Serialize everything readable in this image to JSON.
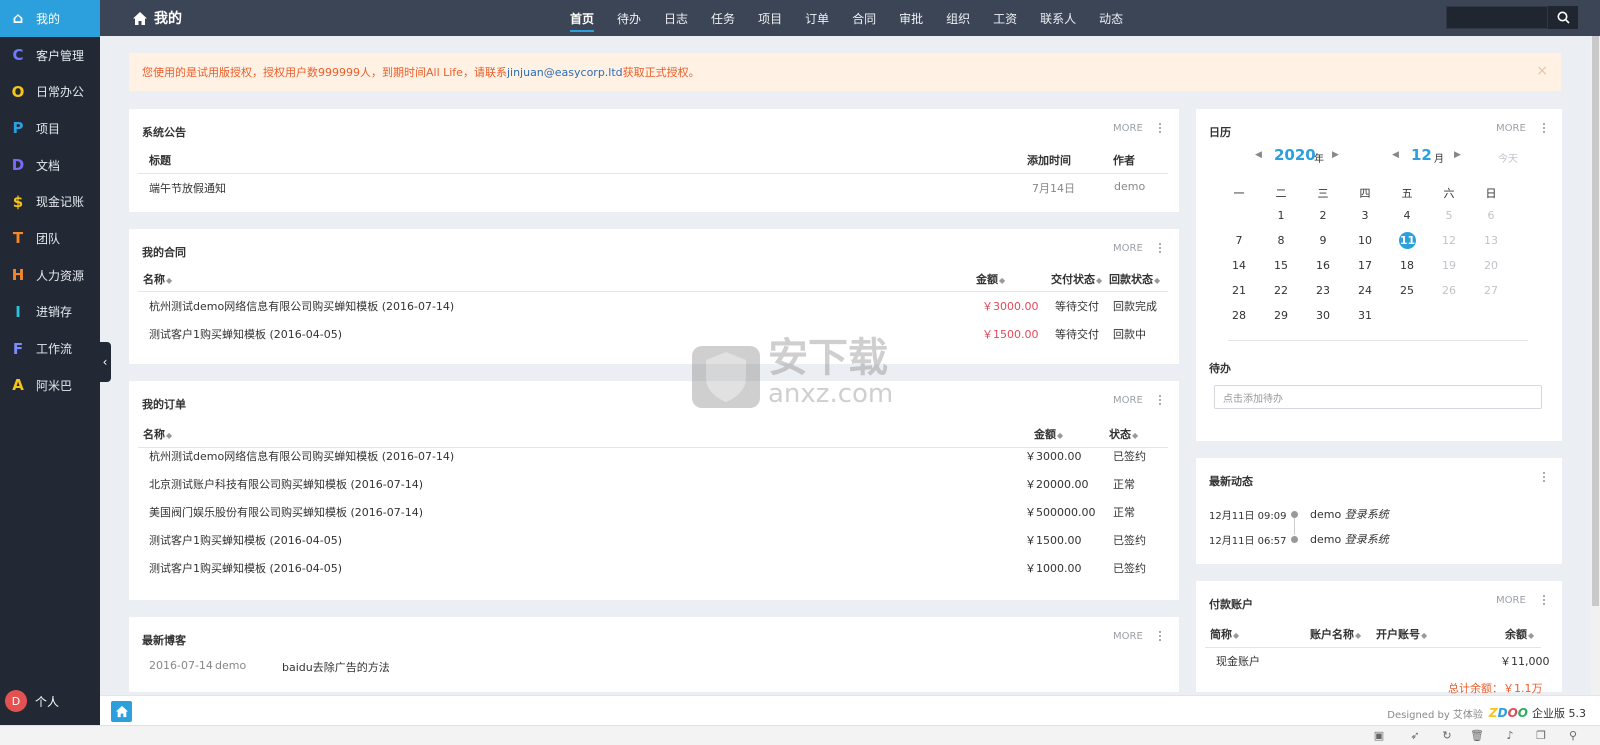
{
  "sidebar": {
    "items": [
      {
        "letter": "⌂",
        "label": "我的",
        "color": "#ffffff",
        "active": true
      },
      {
        "letter": "C",
        "label": "客户管理",
        "color": "#6c7cff"
      },
      {
        "letter": "O",
        "label": "日常办公",
        "color": "#f5c518"
      },
      {
        "letter": "P",
        "label": "项目",
        "color": "#2c9fdd"
      },
      {
        "letter": "D",
        "label": "文档",
        "color": "#7b6cf5"
      },
      {
        "letter": "$",
        "label": "现金记账",
        "color": "#f5c518"
      },
      {
        "letter": "T",
        "label": "团队",
        "color": "#f5872c"
      },
      {
        "letter": "H",
        "label": "人力资源",
        "color": "#f5872c"
      },
      {
        "letter": "I",
        "label": "进销存",
        "color": "#2cc2dd"
      },
      {
        "letter": "F",
        "label": "工作流",
        "color": "#7b8cff"
      },
      {
        "letter": "A",
        "label": "阿米巴",
        "color": "#f5c518"
      }
    ],
    "user": {
      "avatar": "D",
      "label": "个人"
    }
  },
  "topbar": {
    "title": "我的",
    "nav": [
      "首页",
      "待办",
      "日志",
      "任务",
      "项目",
      "订单",
      "合同",
      "审批",
      "组织",
      "工资",
      "联系人",
      "动态"
    ],
    "active_nav": "首页"
  },
  "alert": {
    "text_before": "您使用的是试用版授权，授权用户数999999人，到期时间All Life，请联系",
    "email": "jinjuan@easycorp.ltd",
    "text_after": "获取正式授权。",
    "close": "×"
  },
  "announcements": {
    "title": "系统公告",
    "more": "MORE",
    "headers": {
      "title": "标题",
      "time": "添加时间",
      "author": "作者"
    },
    "rows": [
      {
        "title": "端午节放假通知",
        "time": "7月14日",
        "author": "demo"
      }
    ]
  },
  "contracts": {
    "title": "我的合同",
    "more": "MORE",
    "headers": {
      "name": "名称",
      "amount": "金额",
      "delivery": "交付状态",
      "return": "回款状态"
    },
    "rows": [
      {
        "name": "杭州测试demo网络信息有限公司购买蝉知模板 (2016-07-14)",
        "amount": "￥3000.00",
        "delivery": "等待交付",
        "return": "回款完成"
      },
      {
        "name": "测试客户1购买蝉知模板 (2016-04-05)",
        "amount": "￥1500.00",
        "delivery": "等待交付",
        "return": "回款中"
      }
    ]
  },
  "orders": {
    "title": "我的订单",
    "more": "MORE",
    "headers": {
      "name": "名称",
      "amount": "金额",
      "status": "状态"
    },
    "rows": [
      {
        "name": "杭州测试demo网络信息有限公司购买蝉知模板 (2016-07-14)",
        "amount": "￥3000.00",
        "status": "已签约"
      },
      {
        "name": "北京测试账户科技有限公司购买蝉知模板 (2016-07-14)",
        "amount": "￥20000.00",
        "status": "正常"
      },
      {
        "name": "美国阀门娱乐股份有限公司购买蝉知模板 (2016-07-14)",
        "amount": "￥500000.00",
        "status": "正常"
      },
      {
        "name": "测试客户1购买蝉知模板 (2016-04-05)",
        "amount": "￥1500.00",
        "status": "已签约"
      },
      {
        "name": "测试客户1购买蝉知模板 (2016-04-05)",
        "amount": "￥1000.00",
        "status": "已签约"
      }
    ]
  },
  "blog": {
    "title": "最新博客",
    "more": "MORE",
    "rows": [
      {
        "date": "2016-07-14",
        "author": "demo",
        "title": "baidu去除广告的方法"
      }
    ]
  },
  "calendar": {
    "title": "日历",
    "more": "MORE",
    "year": "2020",
    "year_unit": "年",
    "month": "12",
    "month_unit": "月",
    "today_btn": "今天",
    "weekdays": [
      "一",
      "二",
      "三",
      "四",
      "五",
      "六",
      "日"
    ],
    "weeks": [
      [
        "",
        "1",
        "2",
        "3",
        "4",
        "5",
        "6"
      ],
      [
        "7",
        "8",
        "9",
        "10",
        "11",
        "12",
        "13"
      ],
      [
        "14",
        "15",
        "16",
        "17",
        "18",
        "19",
        "20"
      ],
      [
        "21",
        "22",
        "23",
        "24",
        "25",
        "26",
        "27"
      ],
      [
        "28",
        "29",
        "30",
        "31",
        "",
        "",
        ""
      ]
    ],
    "today": "11",
    "todo_title": "待办",
    "todo_placeholder": "点击添加待办"
  },
  "activity": {
    "title": "最新动态",
    "rows": [
      {
        "time": "12月11日 09:09",
        "user": "demo",
        "action": "登录系统"
      },
      {
        "time": "12月11日 06:57",
        "user": "demo",
        "action": "登录系统"
      }
    ]
  },
  "accounts": {
    "title": "付款账户",
    "more": "MORE",
    "headers": {
      "abbr": "简称",
      "name": "账户名称",
      "bank": "开户账号",
      "balance": "余额"
    },
    "rows": [
      {
        "abbr": "现金账户",
        "name": "",
        "bank": "",
        "balance": "￥11,000"
      }
    ],
    "total": "总计余额：￥1.1万"
  },
  "footer": {
    "designed": "Designed by 艾体验",
    "brand": "ZDOO",
    "edition": "企业版 5.3"
  },
  "watermark": {
    "main": "安下载",
    "sub": "anxz.com"
  }
}
